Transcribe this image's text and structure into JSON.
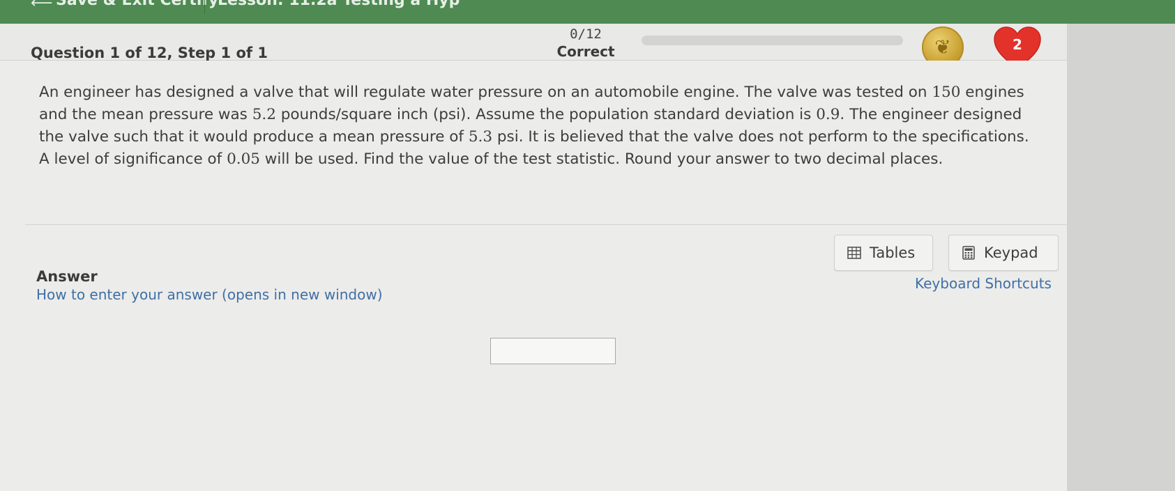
{
  "topbar": {
    "back_label": "⟵",
    "save_exit_label": "Save & Exit Certify",
    "lesson_title": "Lesson: 11.2a Testing a Hyp"
  },
  "header": {
    "question_title": "Question 1 of 12, Step 1 of 1",
    "score": "0/12",
    "score_label": "Correct",
    "progress_fraction": 0,
    "hearts_count": "2"
  },
  "question": {
    "parts": [
      "An engineer has designed a valve that will regulate water pressure on an automobile engine. The valve was tested on ",
      "150",
      " engines and the mean pressure was ",
      "5.2",
      " pounds/square inch (psi). Assume the population standard deviation is ",
      "0.9",
      ". The engineer designed the valve such that it would produce a mean pressure of ",
      "5.3",
      " psi. It is believed that the valve does not perform to the specifications. A level of significance of ",
      "0.05",
      " will be used. Find the value of the test statistic. Round your answer to two decimal places."
    ]
  },
  "answer": {
    "label": "Answer",
    "how_to_link": "How to enter your answer (opens in new window)",
    "tables_label": "Tables",
    "keypad_label": "Keypad",
    "shortcuts_link": "Keyboard Shortcuts",
    "input_value": ""
  },
  "colors": {
    "topbar": "#4e8a52",
    "link": "#3f6fa6",
    "heart": "#e2322a",
    "coin": "#c9a233"
  }
}
